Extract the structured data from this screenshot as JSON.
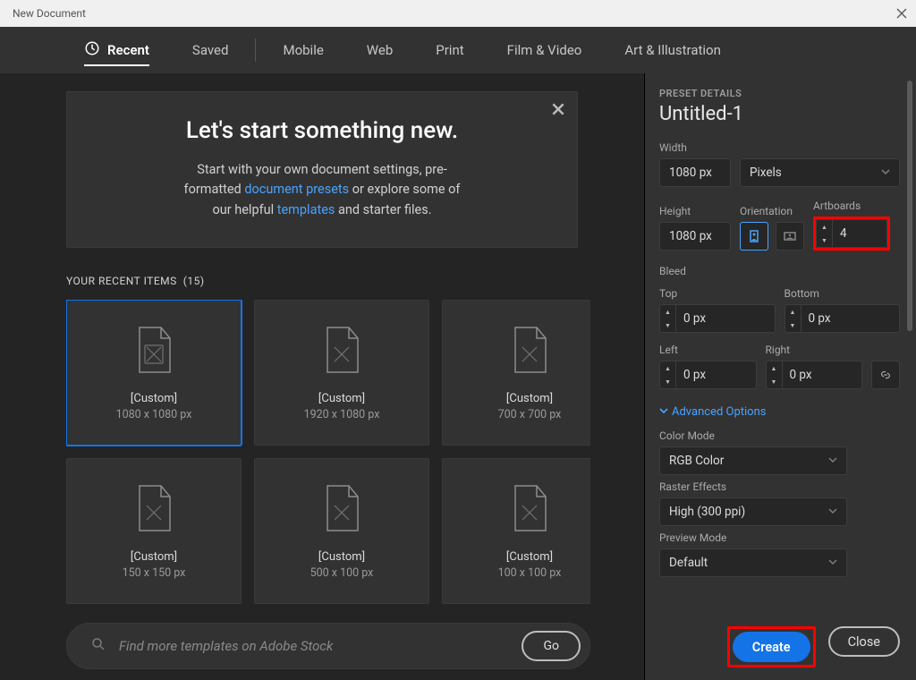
{
  "window": {
    "title": "New Document"
  },
  "tabs": {
    "recent": "Recent",
    "saved": "Saved",
    "mobile": "Mobile",
    "web": "Web",
    "print": "Print",
    "film": "Film & Video",
    "art": "Art & Illustration"
  },
  "hero": {
    "title": "Let's start something new.",
    "line1a": "Start with your own document settings, pre-",
    "line1b": "formatted ",
    "link1": "document presets",
    "line1c": " or explore some of",
    "line2a": "our helpful ",
    "link2": "templates",
    "line2b": " and starter files."
  },
  "recent": {
    "label": "YOUR RECENT ITEMS",
    "count": "(15)",
    "items": [
      {
        "label": "[Custom]",
        "size": "1080 x 1080 px"
      },
      {
        "label": "[Custom]",
        "size": "1920 x 1080 px"
      },
      {
        "label": "[Custom]",
        "size": "700 x 700 px"
      },
      {
        "label": "[Custom]",
        "size": "150 x 150 px"
      },
      {
        "label": "[Custom]",
        "size": "500 x 100 px"
      },
      {
        "label": "[Custom]",
        "size": "100 x 100 px"
      }
    ]
  },
  "search": {
    "placeholder": "Find more templates on Adobe Stock",
    "go": "Go"
  },
  "details": {
    "header": "PRESET DETAILS",
    "name": "Untitled-1",
    "width_label": "Width",
    "width_value": "1080 px",
    "units": "Pixels",
    "height_label": "Height",
    "height_value": "1080 px",
    "orientation_label": "Orientation",
    "artboards_label": "Artboards",
    "artboards_value": "4",
    "bleed_label": "Bleed",
    "top_label": "Top",
    "top_value": "0 px",
    "bottom_label": "Bottom",
    "bottom_value": "0 px",
    "left_label": "Left",
    "left_value": "0 px",
    "right_label": "Right",
    "right_value": "0 px",
    "advanced": "Advanced Options",
    "color_mode_label": "Color Mode",
    "color_mode_value": "RGB Color",
    "raster_label": "Raster Effects",
    "raster_value": "High (300 ppi)",
    "preview_label": "Preview Mode",
    "preview_value": "Default"
  },
  "buttons": {
    "create": "Create",
    "close": "Close"
  }
}
